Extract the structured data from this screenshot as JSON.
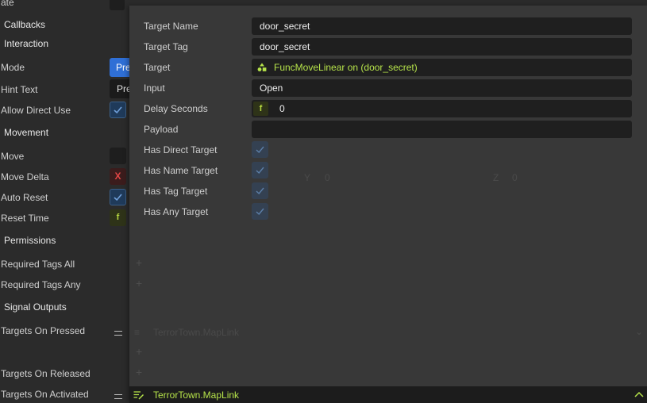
{
  "inspector": {
    "top_cut_label": "ate",
    "rows": [
      {
        "name": "section-callbacks",
        "label": "Callbacks"
      },
      {
        "name": "section-interaction",
        "label": "Interaction"
      },
      {
        "name": "mode",
        "label": "Mode"
      },
      {
        "name": "hint-text",
        "label": "Hint Text"
      },
      {
        "name": "allow-direct-use",
        "label": "Allow Direct Use"
      },
      {
        "name": "section-movement",
        "label": "Movement"
      },
      {
        "name": "move",
        "label": "Move"
      },
      {
        "name": "move-delta",
        "label": "Move Delta"
      },
      {
        "name": "auto-reset",
        "label": "Auto Reset"
      },
      {
        "name": "reset-time",
        "label": "Reset Time"
      },
      {
        "name": "section-permissions",
        "label": "Permissions"
      },
      {
        "name": "required-tags-all",
        "label": "Required Tags All"
      },
      {
        "name": "required-tags-any",
        "label": "Required Tags Any"
      },
      {
        "name": "section-signal-outputs",
        "label": "Signal Outputs"
      },
      {
        "name": "targets-on-pressed",
        "label": "Targets On Pressed"
      },
      {
        "name": "targets-on-released",
        "label": "Targets On Released"
      },
      {
        "name": "targets-on-activated",
        "label": "Targets On Activated"
      }
    ],
    "mode_value": "Pre",
    "hint_value": "Pre",
    "move_delta_x": "X",
    "reset_time_f": "f",
    "ghost_y_label": "Y",
    "ghost_y_value": "0",
    "ghost_z_label": "Z",
    "ghost_z_value": "0",
    "ghost_target_text": "TerrorTown.MapLink"
  },
  "popup": {
    "labels": {
      "target_name": "Target Name",
      "target_tag": "Target Tag",
      "target": "Target",
      "input": "Input",
      "delay_seconds": "Delay Seconds",
      "payload": "Payload",
      "has_direct_target": "Has Direct Target",
      "has_name_target": "Has Name Target",
      "has_tag_target": "Has Tag Target",
      "has_any_target": "Has Any Target"
    },
    "values": {
      "target_name": "door_secret",
      "target_tag": "door_secret",
      "target": "FuncMoveLinear on (door_secret)",
      "input": "Open",
      "delay_seconds_prefix": "f",
      "delay_seconds": "0",
      "payload": ""
    },
    "checks": {
      "has_direct_target": true,
      "has_name_target": true,
      "has_tag_target": true,
      "has_any_target": true
    },
    "accent_color": "#b6e34a"
  },
  "footer": {
    "type_label": "TerrorTown.MapLink"
  }
}
